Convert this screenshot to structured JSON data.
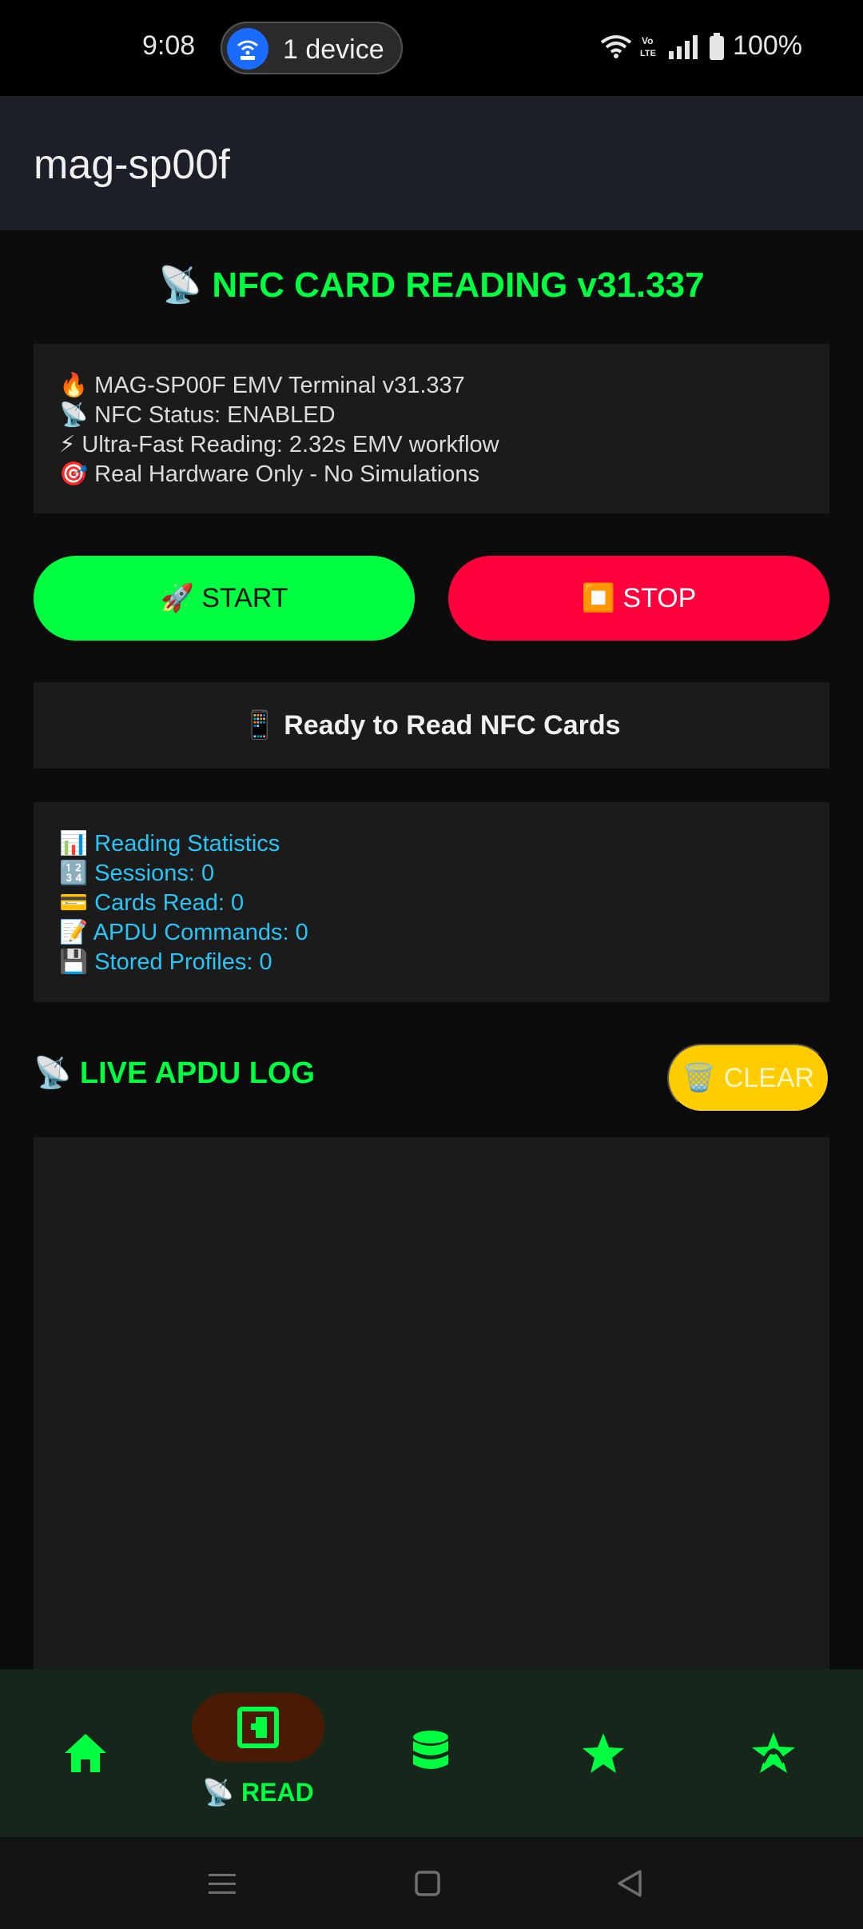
{
  "status_bar": {
    "time": "9:08",
    "device_pill": "1 device",
    "battery": "100%"
  },
  "app_bar": {
    "title": "mag-sp00f"
  },
  "screen": {
    "title": "📡 NFC CARD READING v31.337",
    "info_lines": [
      "🔥 MAG-SP00F EMV Terminal v31.337",
      "📡 NFC Status: ENABLED",
      "⚡ Ultra-Fast Reading: 2.32s EMV workflow",
      "🎯 Real Hardware Only - No Simulations"
    ],
    "start_label": "🚀 START",
    "stop_label": "⏹️ STOP",
    "status_text": "📱 Ready to Read NFC Cards",
    "stats_lines": [
      "📊 Reading Statistics",
      "🔢 Sessions: 0",
      "💳 Cards Read: 0",
      "📝 APDU Commands: 0",
      "💾 Stored Profiles: 0"
    ],
    "log_title": "📡 LIVE APDU LOG",
    "clear_label": "🗑️ CLEAR"
  },
  "bottom_nav": {
    "read_label": "📡 READ",
    "items": [
      "home-icon",
      "read-card-icon",
      "database-icon",
      "star-icon",
      "emulate-icon"
    ]
  },
  "colors": {
    "accent_green": "#00ff41",
    "stop_red": "#ff003d",
    "clear_yellow": "#ffcc00",
    "stats_cyan": "#29c5f6"
  }
}
